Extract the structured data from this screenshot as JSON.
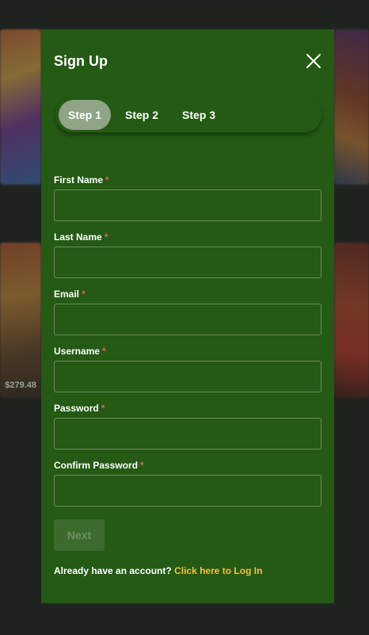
{
  "background": {
    "amount_text": "$279.48"
  },
  "modal": {
    "title": "Sign Up",
    "close_icon": "close-icon",
    "steps": [
      {
        "label": "Step 1",
        "active": true
      },
      {
        "label": "Step 2",
        "active": false
      },
      {
        "label": "Step 3",
        "active": false
      }
    ],
    "fields": {
      "first_name": {
        "label": "First Name",
        "required": "*",
        "value": ""
      },
      "last_name": {
        "label": "Last Name",
        "required": "*",
        "value": ""
      },
      "email": {
        "label": "Email",
        "required": "*",
        "value": ""
      },
      "username": {
        "label": "Username",
        "required": "*",
        "value": ""
      },
      "password": {
        "label": "Password",
        "required": "*",
        "value": ""
      },
      "confirm_password": {
        "label": "Confirm Password",
        "required": "*",
        "value": ""
      }
    },
    "next_label": "Next",
    "login_prompt": "Already have an account?",
    "login_link": "Click here to Log In"
  },
  "colors": {
    "modal_bg": "#245a14",
    "active_step": "#8fa586",
    "required": "#e0665a",
    "link": "#f0c24a"
  }
}
